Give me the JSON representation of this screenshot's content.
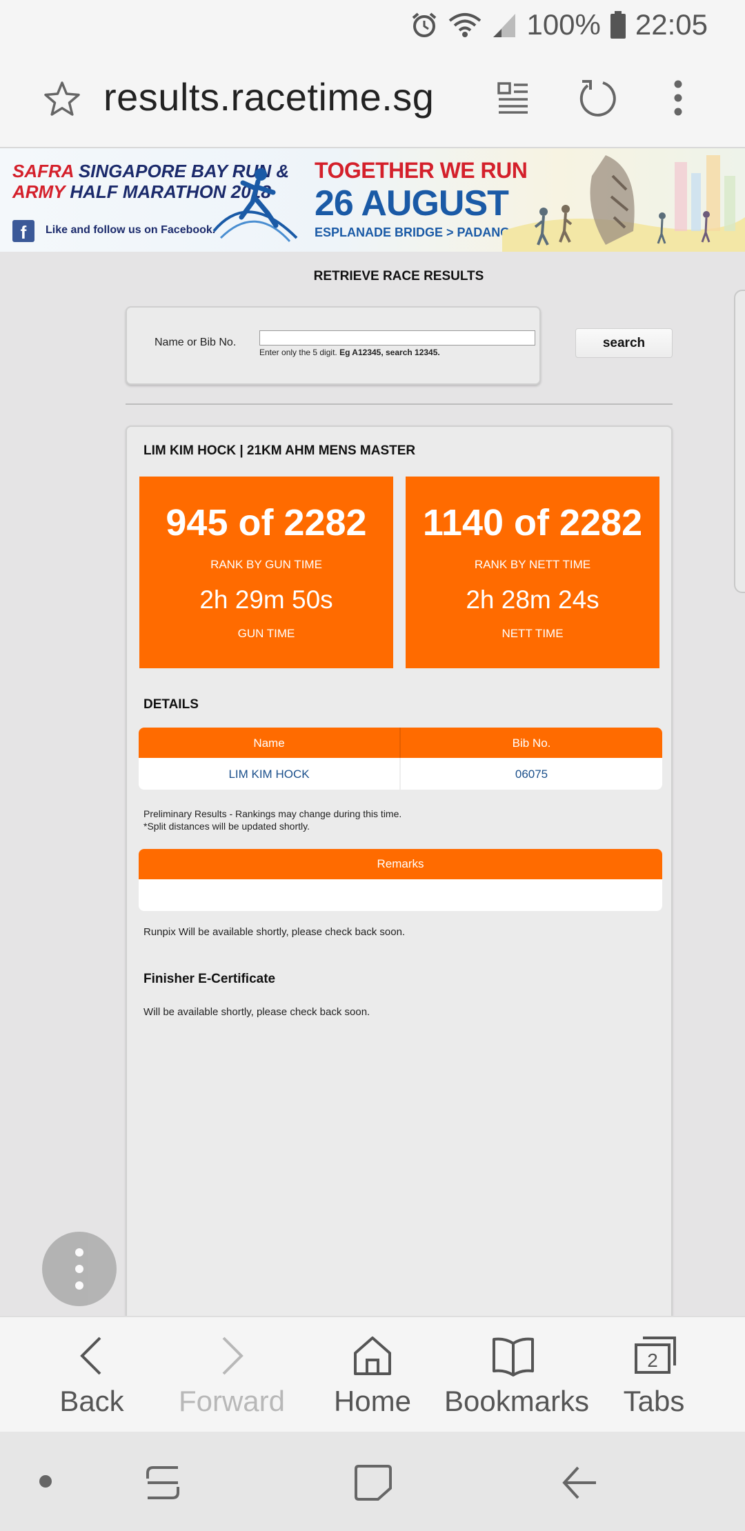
{
  "status_bar": {
    "battery": "100%",
    "time": "22:05"
  },
  "browser": {
    "url": "results.racetime.sg"
  },
  "banner": {
    "line1_red": "SAFRA",
    "line1_blue": "SINGAPORE BAY RUN &",
    "line2_red": "ARMY",
    "line2_blue": "HALF MARATHON 2018",
    "facebook_text": "Like and follow us on Facebook.",
    "tagline": "TOGETHER WE RUN",
    "date": "26 AUGUST",
    "route": "ESPLANADE BRIDGE > PADANG"
  },
  "page": {
    "title": "RETRIEVE RACE RESULTS",
    "search": {
      "label": "Name or Bib No.",
      "value": "",
      "hint_plain": "Enter only the 5 digit.",
      "hint_bold": "Eg A12345, search 12345.",
      "button": "search"
    },
    "result": {
      "heading": "LIM KIM HOCK | 21KM AHM MENS MASTER",
      "gun": {
        "rank": "945 of 2282",
        "rank_label": "RANK BY GUN TIME",
        "time": "2h 29m 50s",
        "time_label": "GUN TIME"
      },
      "nett": {
        "rank": "1140 of 2282",
        "rank_label": "RANK BY NETT TIME",
        "time": "2h 28m 24s",
        "time_label": "NETT TIME"
      },
      "details_title": "DETAILS",
      "details_table": {
        "headers": [
          "Name",
          "Bib No."
        ],
        "row": [
          "LIM KIM HOCK",
          "06075"
        ]
      },
      "prelim_line1": "Preliminary Results - Rankings may change during this time.",
      "prelim_line2": "*Split distances will be updated shortly.",
      "remarks_header": "Remarks",
      "remarks_value": "",
      "runpix": "Runpix Will be available shortly, please check back soon.",
      "cert_title": "Finisher E-Certificate",
      "cert_text": "Will be available shortly, please check back soon."
    }
  },
  "toolbar": {
    "back": "Back",
    "forward": "Forward",
    "home": "Home",
    "bookmarks": "Bookmarks",
    "tabs": "Tabs",
    "tab_count": "2"
  },
  "colors": {
    "accent": "#ff6b00",
    "link": "#1a4f8b",
    "page_bg": "#e5e4e5"
  }
}
